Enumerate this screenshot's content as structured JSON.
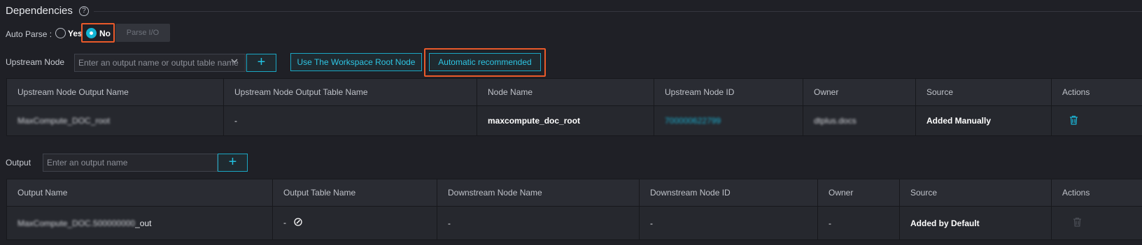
{
  "section": {
    "title": "Dependencies",
    "help_glyph": "?"
  },
  "auto_parse": {
    "label": "Auto Parse :",
    "yes_label": "Yes",
    "no_label": "No",
    "selected": "No",
    "parse_button": "Parse I/O"
  },
  "upstream": {
    "label": "Upstream Node",
    "select_placeholder": "Enter an output name or output table name",
    "add_glyph": "+",
    "root_button": "Use The Workspace Root Node",
    "recommend_button": "Automatic recommended",
    "columns": [
      "Upstream Node Output Name",
      "Upstream Node Output Table Name",
      "Node Name",
      "Upstream Node ID",
      "Owner",
      "Source",
      "Actions"
    ],
    "rows": [
      {
        "output_name": "MaxCompute_DOC_root",
        "table_name": "-",
        "node_name": "maxcompute_doc_root",
        "node_id": "700000622799",
        "owner": "dtplus.docs",
        "source": "Added Manually"
      }
    ]
  },
  "output": {
    "label": "Output",
    "input_placeholder": "Enter an output name",
    "add_glyph": "+",
    "columns": [
      "Output Name",
      "Output Table Name",
      "Downstream Node Name",
      "Downstream Node ID",
      "Owner",
      "Source",
      "Actions"
    ],
    "rows": [
      {
        "output_name_blurred": "MaxCompute_DOC.500000000",
        "output_name_suffix": "_out",
        "table_name": "-",
        "downstream_name": "-",
        "downstream_id": "-",
        "owner": "-",
        "source": "Added by Default"
      }
    ]
  },
  "colors": {
    "accent": "#1bb2d3",
    "highlight": "#ea5a2a",
    "background": "#1f2026"
  },
  "icons": [
    "help-icon",
    "chevron-down-icon",
    "plus-icon",
    "trash-icon",
    "edit-icon"
  ]
}
